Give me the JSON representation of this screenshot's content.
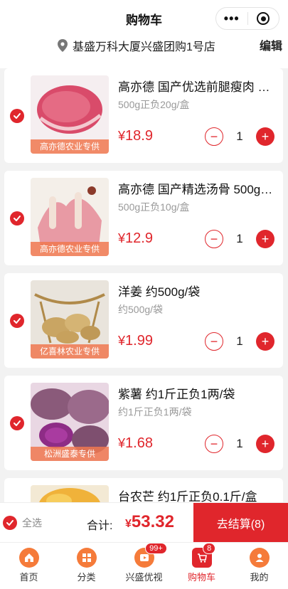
{
  "header": {
    "title": "购物车",
    "store_name": "基盛万科大厦兴盛团购1号店",
    "edit_label": "编辑",
    "menu_icon": "more-dots-icon",
    "close_icon": "target-icon"
  },
  "cart": {
    "items": [
      {
        "name": "高亦德 国产优选前腿瘦肉 500g正负20g/盒",
        "spec": "500g正负20g/盒",
        "currency": "¥",
        "price": "18.9",
        "quantity": "1",
        "supplier": "高亦德农业专供",
        "checked": true
      },
      {
        "name": "高亦德 国产精选汤骨 500g正负10g/盒",
        "spec": "500g正负10g/盒",
        "currency": "¥",
        "price": "12.9",
        "quantity": "1",
        "supplier": "高亦德农业专供",
        "checked": true
      },
      {
        "name": "洋姜 约500g/袋",
        "spec": "约500g/袋",
        "currency": "¥",
        "price": "1.99",
        "quantity": "1",
        "supplier": "亿喜林农业专供",
        "checked": true
      },
      {
        "name": "紫薯 约1斤正负1两/袋",
        "spec": "约1斤正负1两/袋",
        "currency": "¥",
        "price": "1.68",
        "quantity": "1",
        "supplier": "松洲盛泰专供",
        "checked": true
      },
      {
        "name": "台农芒 约1斤正负0.1斤/盒",
        "spec": "",
        "currency": "",
        "price": "",
        "quantity": "",
        "supplier": "",
        "checked": true
      }
    ],
    "minus": "−",
    "plus": "+"
  },
  "checkout": {
    "select_all_label": "全选",
    "total_label": "合计:",
    "currency": "¥",
    "total": "53.32",
    "button_label": "去结算(8)"
  },
  "tabbar": {
    "tabs": [
      {
        "label": "首页",
        "icon": "home-icon"
      },
      {
        "label": "分类",
        "icon": "category-icon"
      },
      {
        "label": "兴盛优视",
        "icon": "video-icon",
        "badge": "99+"
      },
      {
        "label": "购物车",
        "icon": "cart-icon",
        "badge": "8",
        "active": true
      },
      {
        "label": "我的",
        "icon": "user-icon"
      }
    ]
  },
  "colors": {
    "accent": "#e0262c",
    "tab_icon": "#f57b3a"
  }
}
